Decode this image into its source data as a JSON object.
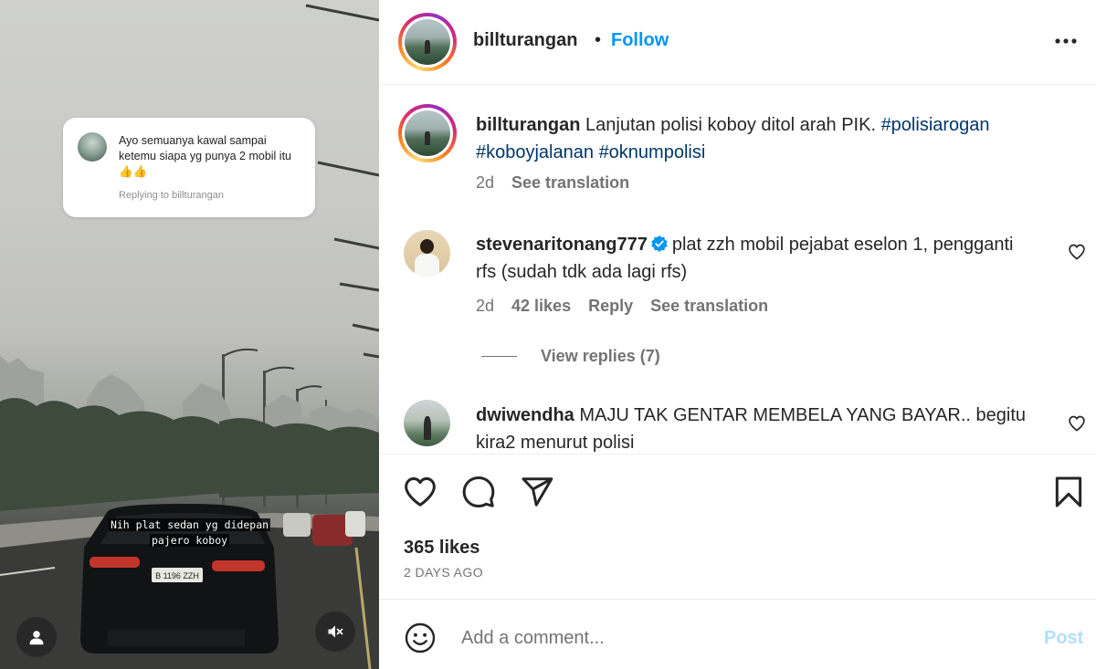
{
  "media": {
    "reply_card": {
      "text": "Ayo semuanya kawal sampai ketemu siapa yg punya 2 mobil itu 👍👍",
      "replying_to": "Replying to billturangan"
    },
    "overlay_caption_line1": "Nih plat sedan yg didepan",
    "overlay_caption_line2": "pajero koboy",
    "license_plate": "B 1196 ZZH"
  },
  "header": {
    "username": "billturangan",
    "separator": "•",
    "follow_label": "Follow"
  },
  "caption": {
    "username": "billturangan",
    "text": "Lanjutan polisi koboy ditol arah PIK.",
    "hashtags": [
      "#polisiarogan",
      "#koboyjalanan",
      "#oknumpolisi"
    ],
    "time": "2d",
    "see_translation": "See translation"
  },
  "comments": [
    {
      "username": "stevenaritonang777",
      "verified": true,
      "text": "plat zzh mobil pejabat eselon 1, pengganti rfs (sudah tdk ada lagi rfs)",
      "time": "2d",
      "likes": "42 likes",
      "reply_label": "Reply",
      "see_translation": "See translation",
      "view_replies": "View replies (7)"
    },
    {
      "username": "dwiwendha",
      "text": "MAJU TAK GENTAR MEMBELA YANG BAYAR.. begitu kira2 menurut polisi"
    }
  ],
  "stats": {
    "likes": "365 likes",
    "date": "2 DAYS AGO"
  },
  "add_comment": {
    "placeholder": "Add a comment...",
    "post_label": "Post"
  },
  "colors": {
    "accent": "#0095f6",
    "hashtag": "#00376b",
    "muted": "#737373",
    "post_disabled": "#b2dffc"
  }
}
